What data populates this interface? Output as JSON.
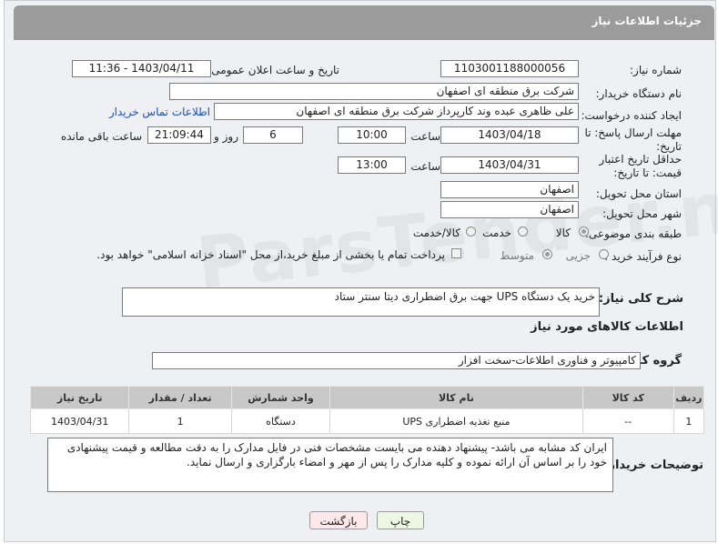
{
  "header": {
    "title": "جزئیات اطلاعات نیاز"
  },
  "fields": {
    "need_no_label": "شماره نیاز:",
    "need_no": "1103001188000056",
    "announce_label": "تاریخ و ساعت اعلان عمومی:",
    "announce_value": "1403/04/11 - 11:36",
    "buyer_label": "نام دستگاه خریدار:",
    "buyer": "شرکت برق منطقه ای اصفهان",
    "creator_label": "ایجاد کننده درخواست:",
    "creator": "علی ظاهری عبده وند کارپرداز شرکت برق منطقه ای اصفهان",
    "contact_link": "اطلاعات تماس خریدار",
    "deadline_label": "مهلت ارسال پاسخ: تا تاریخ:",
    "deadline_date": "1403/04/18",
    "time_word": "ساعت",
    "deadline_time": "10:00",
    "days": "6",
    "days_and": "روز و",
    "remaining": "21:09:44",
    "remaining_label": "ساعت باقی مانده",
    "validity_label": "حداقل تاریخ اعتبار قیمت: تا تاریخ:",
    "validity_date": "1403/04/31",
    "validity_time": "13:00",
    "province_label": "استان محل تحویل:",
    "province": "اصفهان",
    "city_label": "شهر محل تحویل:",
    "city": "اصفهان",
    "category_label": "طبقه بندی موضوعی:",
    "cat_goods": "کالا",
    "cat_service": "خدمت",
    "cat_both": "کالا/خدمت",
    "process_label": "نوع فرآیند خرید :",
    "proc_partial": "جزیی",
    "proc_medium": "متوسط",
    "payment_note": "پرداخت تمام یا بخشی از مبلغ خرید،از محل \"اسناد خزانه اسلامی\" خواهد بود."
  },
  "summary": {
    "label": "شرح کلی نیاز:",
    "text": "خرید یک دستگاه UPS جهت برق اضطراری دیتا سنتر ستاد"
  },
  "goods": {
    "section_title": "اطلاعات کالاهای مورد نیاز",
    "group_label": "گروه کالا:",
    "group_value": "کامپیوتر و فناوری اطلاعات-سخت افزار",
    "columns": [
      "ردیف",
      "کد کالا",
      "نام کالا",
      "واحد شمارش",
      "تعداد / مقدار",
      "تاریخ نیاز"
    ],
    "rows": [
      {
        "idx": "1",
        "code": "--",
        "name": "منبع تغذیه اضطراری UPS",
        "unit": "دستگاه",
        "qty": "1",
        "date": "1403/04/31"
      }
    ]
  },
  "buyer_notes": {
    "label": "توضیحات خریدار:",
    "text": "ایران کد مشابه می باشد- پیشنهاد دهنده می بایست مشخصات فنی در فایل مدارک  را به دقت مطالعه و قیمت پیشنهادی خود را بر اساس آن ارائه نموده و کلیه مدارک را پس از مهر و امضاء بارگزاری و ارسال نماید."
  },
  "buttons": {
    "print": "چاپ",
    "back": "بازگشت"
  },
  "watermark": "ParsTender.net",
  "colors": {
    "header_bg": "#9b9b9b",
    "link": "#1a4fc4",
    "back_btn_bg": "#fde9ea",
    "print_btn_bg": "#eef7e4"
  }
}
